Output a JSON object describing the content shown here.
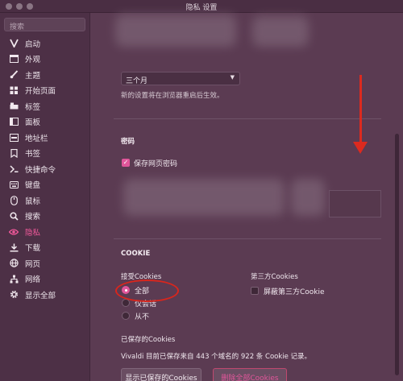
{
  "window": {
    "title": "隐私 设置"
  },
  "sidebar": {
    "search_placeholder": "搜索",
    "items": [
      {
        "label": "启动",
        "icon": "vivaldi-logo-icon"
      },
      {
        "label": "外观",
        "icon": "window-icon"
      },
      {
        "label": "主题",
        "icon": "brush-icon"
      },
      {
        "label": "开始页面",
        "icon": "grid-icon"
      },
      {
        "label": "标签",
        "icon": "tabs-icon"
      },
      {
        "label": "面板",
        "icon": "panel-icon"
      },
      {
        "label": "地址栏",
        "icon": "address-bar-icon"
      },
      {
        "label": "书签",
        "icon": "bookmark-icon"
      },
      {
        "label": "快捷命令",
        "icon": "command-icon"
      },
      {
        "label": "键盘",
        "icon": "keyboard-icon"
      },
      {
        "label": "鼠标",
        "icon": "mouse-icon"
      },
      {
        "label": "搜索",
        "icon": "search-icon"
      },
      {
        "label": "隐私",
        "icon": "eye-icon",
        "active": true
      },
      {
        "label": "下载",
        "icon": "download-icon"
      },
      {
        "label": "网页",
        "icon": "globe-icon"
      },
      {
        "label": "网络",
        "icon": "network-icon"
      },
      {
        "label": "显示全部",
        "icon": "gear-icon"
      }
    ]
  },
  "history": {
    "select_value": "三个月",
    "note": "新的设置将在浏览器重启后生效。"
  },
  "password": {
    "section_title": "密码",
    "save_label": "保存网页密码",
    "save_checked": true
  },
  "cookie": {
    "section_title": "COOKIE",
    "accept_title": "接受Cookies",
    "options": [
      {
        "label": "全部",
        "selected": true
      },
      {
        "label": "仅会话",
        "selected": false
      },
      {
        "label": "从不",
        "selected": false
      }
    ],
    "third_party_title": "第三方Cookies",
    "block_third_party_label": "屏蔽第三方Cookie",
    "block_third_party_checked": false,
    "saved_title": "已保存的Cookies",
    "saved_info": "Vivaldi 目前已保存来自 443 个域名的 922 条 Cookie 记录。",
    "show_button": "显示已保存的Cookies",
    "delete_button": "删除全部Cookies"
  },
  "colors": {
    "accent": "#e0569a",
    "annotation_red": "#dc2a1f",
    "background": "#5b3b52",
    "sidebar": "#4d3046"
  }
}
